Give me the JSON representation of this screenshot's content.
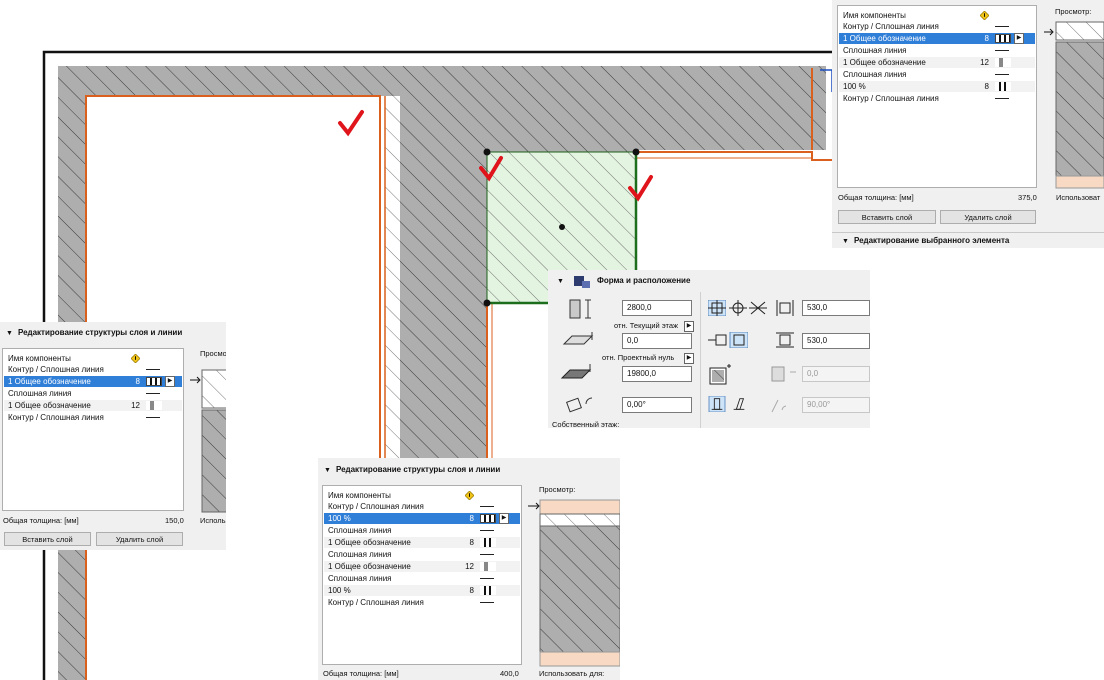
{
  "panel_top": {
    "columns": {
      "name": "Имя компоненты"
    },
    "rows": [
      {
        "text": "Контур / Сплошная линия",
        "num": "",
        "kind": "line"
      },
      {
        "text": "1 Общее обозначение",
        "num": "8",
        "kind": "selected"
      },
      {
        "text": "Сплошная линия",
        "num": "",
        "kind": "line"
      },
      {
        "text": "1 Общее обозначение",
        "num": "12",
        "kind": "gray"
      },
      {
        "text": "Сплошная линия",
        "num": "",
        "kind": "line"
      },
      {
        "text": "100 %",
        "num": "8",
        "kind": "thin"
      },
      {
        "text": "Контур / Сплошная линия",
        "num": "",
        "kind": "line"
      }
    ],
    "preview_label": "Просмотр:",
    "total_label": "Общая толщина: [мм]",
    "total_value": "375,0",
    "use_label": "Использоват",
    "insert_btn": "Вставить слой",
    "delete_btn": "Удалить слой",
    "section_title": "Редактирование выбранного элемента"
  },
  "panel_left": {
    "title": "Редактирование структуры слоя и линии",
    "columns": {
      "name": "Имя компоненты"
    },
    "rows": [
      {
        "text": "Контур / Сплошная линия",
        "num": "",
        "kind": "line"
      },
      {
        "text": "1 Общее обозначение",
        "num": "8",
        "kind": "selected"
      },
      {
        "text": "Сплошная линия",
        "num": "",
        "kind": "line"
      },
      {
        "text": "1 Общее обозначение",
        "num": "12",
        "kind": "gray"
      },
      {
        "text": "Контур / Сплошная линия",
        "num": "",
        "kind": "line"
      }
    ],
    "preview_label": "Просмотр",
    "total_label": "Общая толщина: [мм]",
    "total_value": "150,0",
    "use_label": "Использ",
    "insert_btn": "Вставить слой",
    "delete_btn": "Удалить слой"
  },
  "panel_bottom": {
    "title": "Редактирование структуры слоя и линии",
    "columns": {
      "name": "Имя компоненты"
    },
    "rows": [
      {
        "text": "Контур / Сплошная линия",
        "num": "",
        "kind": "line"
      },
      {
        "text": "100 %",
        "num": "8",
        "kind": "selected"
      },
      {
        "text": "Сплошная линия",
        "num": "",
        "kind": "line"
      },
      {
        "text": "1 Общее обозначение",
        "num": "8",
        "kind": "thin"
      },
      {
        "text": "Сплошная линия",
        "num": "",
        "kind": "line"
      },
      {
        "text": "1 Общее обозначение",
        "num": "12",
        "kind": "gray"
      },
      {
        "text": "Сплошная линия",
        "num": "",
        "kind": "line"
      },
      {
        "text": "100 %",
        "num": "8",
        "kind": "thin"
      },
      {
        "text": "Контур / Сплошная линия",
        "num": "",
        "kind": "line"
      }
    ],
    "preview_label": "Просмотр:",
    "total_label": "Общая толщина: [мм]",
    "total_value": "400,0",
    "use_label": "Использовать для:"
  },
  "panel_shape": {
    "title": "Форма и расположение",
    "height": "2800,0",
    "floor_label": "отн. Текущий этаж",
    "floor_offset": "0,0",
    "zero_label": "отн. Проектный нуль",
    "zero_offset": "19800,0",
    "angle": "0,00°",
    "width": "530,0",
    "depth": "530,0",
    "slant": "0,0",
    "slant_angle": "90,00°",
    "footer": "Собственный этаж:"
  },
  "colors": {
    "selection": "#2f7ed8",
    "wall_fill": "#a9a9a9",
    "column_fill": "#e3f4e1",
    "accent": "#d9601d",
    "check": "#e0141b"
  }
}
